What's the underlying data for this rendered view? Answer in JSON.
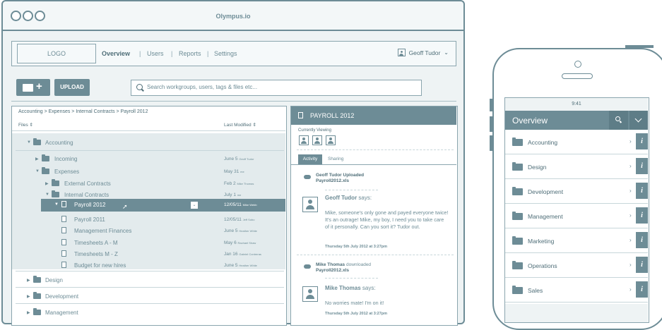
{
  "browser": {
    "title": "Olympus.io"
  },
  "header": {
    "logo": "LOGO",
    "nav": [
      "Overview",
      "Users",
      "Reports",
      "Settings"
    ],
    "separators": [
      "|",
      "|",
      "|"
    ],
    "user_name": "Geoff Tudor"
  },
  "toolbar": {
    "upload_label": "UPLOAD",
    "search_placeholder": "Search workgroups, users, tags & files etc..."
  },
  "filepanel": {
    "breadcrumb": "Accounting  >  Expenses  >  Internal Contracts  >  Payroll 2012",
    "col_files": "Files ⇕",
    "col_modified": "Last Modified ⇕",
    "rows": [
      {
        "name": "Accounting",
        "date": "",
        "by": ""
      },
      {
        "name": "Incoming",
        "date": "June 5",
        "by": "Geoff Tudor"
      },
      {
        "name": "Expenses",
        "date": "May 31",
        "by": "me"
      },
      {
        "name": "External Contracts",
        "date": "Feb 2",
        "by": "Mike Thomas"
      },
      {
        "name": "Internal Contracts",
        "date": "July 1",
        "by": "me"
      },
      {
        "name": "Payroll 2012",
        "date": "12/05/11",
        "by": "Mike Webb"
      },
      {
        "name": "Payroll 2011",
        "date": "12/05/11",
        "by": "Jeff Sobo"
      },
      {
        "name": "Management Finances",
        "date": "June 5",
        "by": "Heather White"
      },
      {
        "name": "Timesheets A - M",
        "date": "May 6",
        "by": "Rachael Shaw"
      },
      {
        "name": "Timesheets M - Z",
        "date": "Jan 16",
        "by": "Gabriel Contreras"
      },
      {
        "name": "Budget for new hires",
        "date": "June 5",
        "by": "Heather White"
      },
      {
        "name": "Design",
        "date": "",
        "by": ""
      },
      {
        "name": "Development",
        "date": "",
        "by": ""
      },
      {
        "name": "Management",
        "date": "",
        "by": ""
      }
    ]
  },
  "detail": {
    "title": "PAYROLL 2012",
    "currently_viewing": "Currently Viewing",
    "tabs": [
      "Activity",
      "Sharing"
    ],
    "event1": {
      "actor": "Geoff Tudor Uploaded",
      "file": "Payroll2012.xls"
    },
    "comment1": {
      "author": "Geoff Tudor",
      "says": " says:",
      "body": "Mike, someone's only gone and payed everyone twice! It's an outrage! Mike, my boy, I need you to take care of it personally.  Can you sort it? Tudor out.",
      "date": "Thursday 5th July 2012 at 3:27pm"
    },
    "event2": {
      "actor": "Mike Thomas",
      "action": " downloaded",
      "file": "Payroll2012.xls"
    },
    "comment2": {
      "author": "Mike Thomas",
      "says": " says:",
      "body": "No worries mate! I'm on it!",
      "date": "Thursday 5th July 2012 at 3:27pm"
    }
  },
  "phone": {
    "time": "9:41",
    "title": "Overview",
    "items": [
      "Accounting",
      "Design",
      "Development",
      "Management",
      "Marketing",
      "Operations",
      "Sales"
    ],
    "chevron": "›",
    "info": "i"
  },
  "colors": {
    "primary": "#6d8c96",
    "dark": "#4f6e78",
    "panel_bg": "#eef3f4"
  }
}
